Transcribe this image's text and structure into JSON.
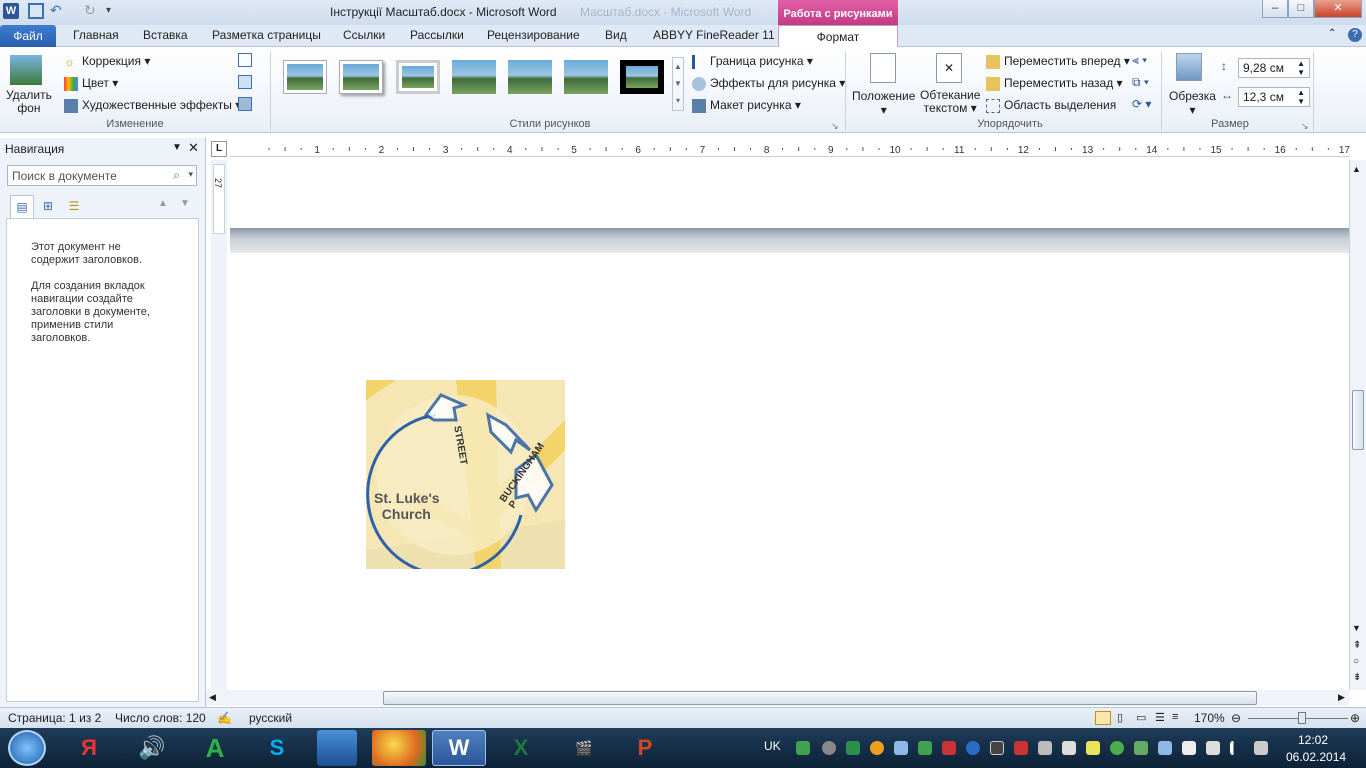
{
  "window": {
    "title": "Інструкції Масштаб.docx - Microsoft Word",
    "title_ghost": "Масштаб.docx - Microsoft Word",
    "context_header": "Работа с рисунками"
  },
  "tabs": {
    "file": "Файл",
    "items": [
      "Главная",
      "Вставка",
      "Разметка страницы",
      "Ссылки",
      "Рассылки",
      "Рецензирование",
      "Вид",
      "ABBYY FineReader 11"
    ],
    "active": "Формат"
  },
  "ribbon": {
    "remove_bg": [
      "Удалить",
      "фон"
    ],
    "correction": "Коррекция",
    "color": "Цвет",
    "art_effects": "Художественные эффекты",
    "group_change": "Изменение",
    "group_styles": "Стили рисунков",
    "border": "Граница рисунка",
    "effects": "Эффекты для рисунка",
    "layout": "Макет рисунка",
    "position": "Положение",
    "wrap": [
      "Обтекание",
      "текстом"
    ],
    "bring_forward": "Переместить вперед",
    "send_backward": "Переместить назад",
    "selection_pane": "Область выделения",
    "group_arrange": "Упорядочить",
    "crop": "Обрезка",
    "height": "9,28 см",
    "width": "12,3 см",
    "group_size": "Размер"
  },
  "nav": {
    "title": "Навигация",
    "search_placeholder": "Поиск в документе",
    "msg1": "Этот документ не содержит заголовков.",
    "msg2": "Для создания вкладок навигации создайте заголовки в документе, применив стили заголовков."
  },
  "ruler": {
    "numbers": [
      "1",
      "2",
      "3",
      "4",
      "5",
      "6",
      "7",
      "8",
      "9",
      "10",
      "11",
      "12",
      "13",
      "14",
      "15",
      "16",
      "17"
    ],
    "vertical": "27"
  },
  "image": {
    "street1": "STREET",
    "street2": "BUCKINGHAM P",
    "church1": "St. Luke's",
    "church2": "Church"
  },
  "status": {
    "page": "Страница: 1 из 2",
    "words": "Число слов: 120",
    "lang": "русский",
    "zoom": "170%"
  },
  "taskbar": {
    "lang": "UK",
    "time": "12:02",
    "date": "06.02.2014"
  }
}
